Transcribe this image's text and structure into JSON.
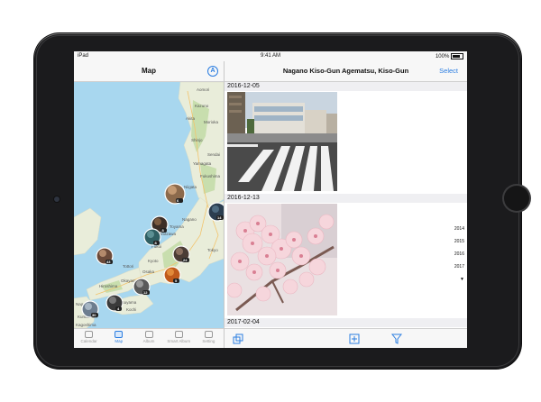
{
  "status_bar": {
    "device": "iPad",
    "time": "9:41 AM",
    "battery": "100%"
  },
  "left_panel": {
    "title": "Map",
    "location_button_glyph": "A",
    "map_labels": [
      {
        "id": "a",
        "text": "Aomori"
      },
      {
        "id": "b",
        "text": "Kazuno"
      },
      {
        "id": "c",
        "text": "Akita"
      },
      {
        "id": "d",
        "text": "Morioka"
      },
      {
        "id": "e",
        "text": "Shinjo"
      },
      {
        "id": "f",
        "text": "Sendai"
      },
      {
        "id": "g",
        "text": "Yamagata"
      },
      {
        "id": "h",
        "text": "Fukushima"
      },
      {
        "id": "i",
        "text": "Niigata"
      },
      {
        "id": "j",
        "text": "Nagano"
      },
      {
        "id": "k",
        "text": "Kanazawa"
      },
      {
        "id": "l",
        "text": "Toyama"
      },
      {
        "id": "m",
        "text": "Fukui"
      },
      {
        "id": "n",
        "text": "Tottori"
      },
      {
        "id": "o",
        "text": "Okayama"
      },
      {
        "id": "p",
        "text": "Kyoto"
      },
      {
        "id": "q",
        "text": "Osaka"
      },
      {
        "id": "r",
        "text": "Hiroshima"
      },
      {
        "id": "s",
        "text": "Matsuyama"
      },
      {
        "id": "t",
        "text": "Kochi"
      },
      {
        "id": "u",
        "text": "Nagasaki"
      },
      {
        "id": "v",
        "text": "Kumamoto"
      },
      {
        "id": "w",
        "text": "Kagoshima"
      },
      {
        "id": "x",
        "text": "Tokyo"
      }
    ],
    "clusters": [
      {
        "id": "c1",
        "count": "6"
      },
      {
        "id": "c2",
        "count": "14"
      },
      {
        "id": "c3",
        "count": "8"
      },
      {
        "id": "c4",
        "count": "8"
      },
      {
        "id": "c5",
        "count": "24"
      },
      {
        "id": "c6",
        "count": "43"
      },
      {
        "id": "c7",
        "count": "5"
      },
      {
        "id": "c8",
        "count": "12"
      },
      {
        "id": "c9",
        "count": "4"
      },
      {
        "id": "c10",
        "count": "30"
      }
    ],
    "tabs": [
      {
        "label": "Calendar",
        "active": false,
        "icon": "calendar-icon"
      },
      {
        "label": "Map",
        "active": true,
        "icon": "map-icon"
      },
      {
        "label": "Album",
        "active": false,
        "icon": "album-icon"
      },
      {
        "label": "Smart Album",
        "active": false,
        "icon": "smart-album-icon"
      },
      {
        "label": "Setting",
        "active": false,
        "icon": "settings-icon"
      }
    ]
  },
  "right_panel": {
    "title": "Nagano Kiso-Gun Agematsu, Kiso-Gun",
    "select_label": "Select",
    "sections": [
      {
        "date": "2016-12-05",
        "photo": "street-crosswalk-photo"
      },
      {
        "date": "2016-12-13",
        "photo": "cherry-blossom-photo"
      },
      {
        "date": "2017-02-04"
      }
    ],
    "year_index": [
      "2014",
      "2015",
      "2016",
      "2017",
      "▼"
    ],
    "toolbar": [
      {
        "icon": "share-icon"
      },
      {
        "icon": "add-icon"
      },
      {
        "icon": "filter-icon"
      }
    ]
  },
  "colors": {
    "accent": "#2a7de1",
    "sea": "#a8d7ef",
    "land": "#e9edda",
    "forest": "#c8deae",
    "bezel": "#1b1b1d"
  }
}
